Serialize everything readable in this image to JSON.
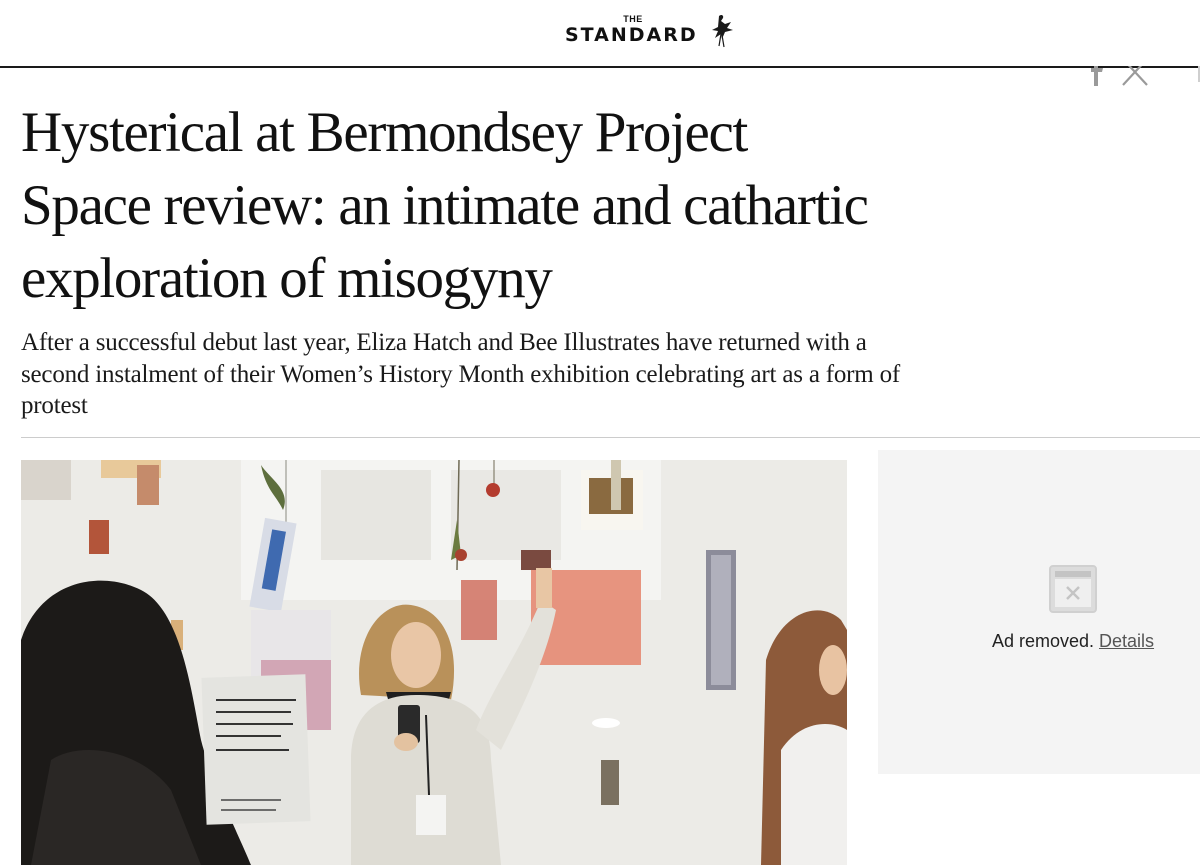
{
  "header": {
    "logo_the": "THE",
    "logo_word": "STANDARD",
    "logo_icon": "bird-icon"
  },
  "share": {
    "icons": [
      "facebook-icon",
      "x-icon"
    ]
  },
  "article": {
    "headline": "Hysterical at Bermondsey Project Space review: an intimate and cathartic exploration of misogyny",
    "standfirst": "After a successful debut last year, Eliza Hatch and Bee Illustrates have returned with a second instalment of their Women’s History Month exhibition celebrating art as a form of protest",
    "hero_image_icon": "exhibition-photo"
  },
  "ad": {
    "icon": "ad-removed-icon",
    "text": "Ad removed.",
    "link_label": "Details"
  },
  "colors": {
    "text": "#111111",
    "rule": "#cccccc",
    "ad_background": "#f4f4f4"
  }
}
